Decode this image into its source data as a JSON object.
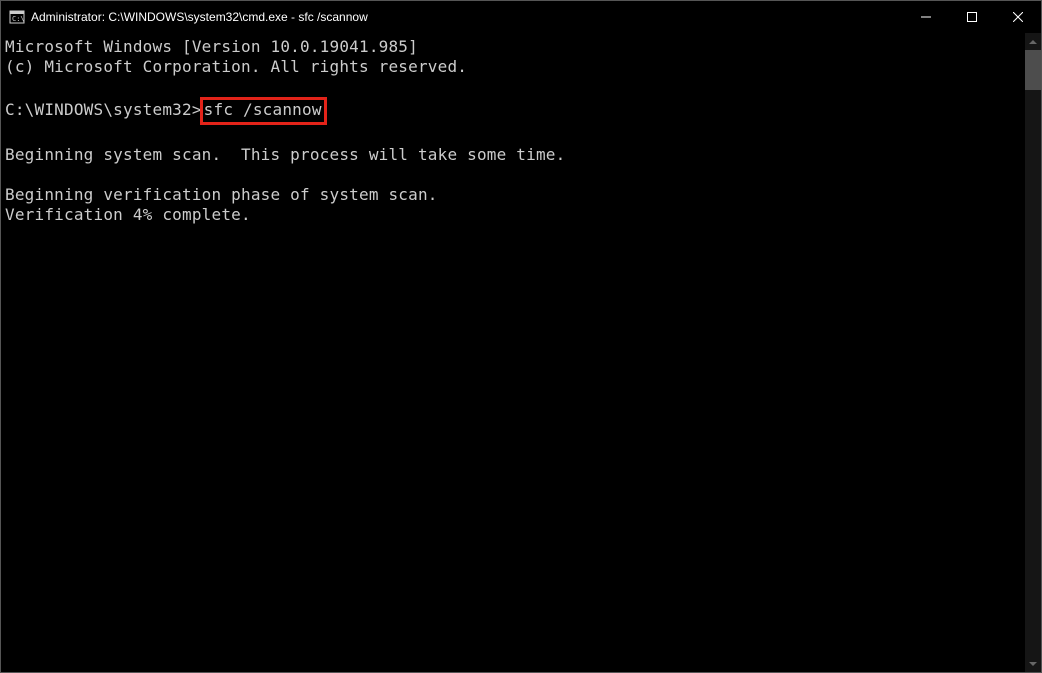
{
  "titlebar": {
    "title": "Administrator: C:\\WINDOWS\\system32\\cmd.exe - sfc  /scannow"
  },
  "terminal": {
    "line1": "Microsoft Windows [Version 10.0.19041.985]",
    "line2": "(c) Microsoft Corporation. All rights reserved.",
    "blank1": "",
    "prompt": "C:\\WINDOWS\\system32>",
    "command": "sfc /scannow",
    "blank2": "",
    "line4": "Beginning system scan.  This process will take some time.",
    "blank3": "",
    "line5": "Beginning verification phase of system scan.",
    "line6": "Verification 4% complete."
  }
}
